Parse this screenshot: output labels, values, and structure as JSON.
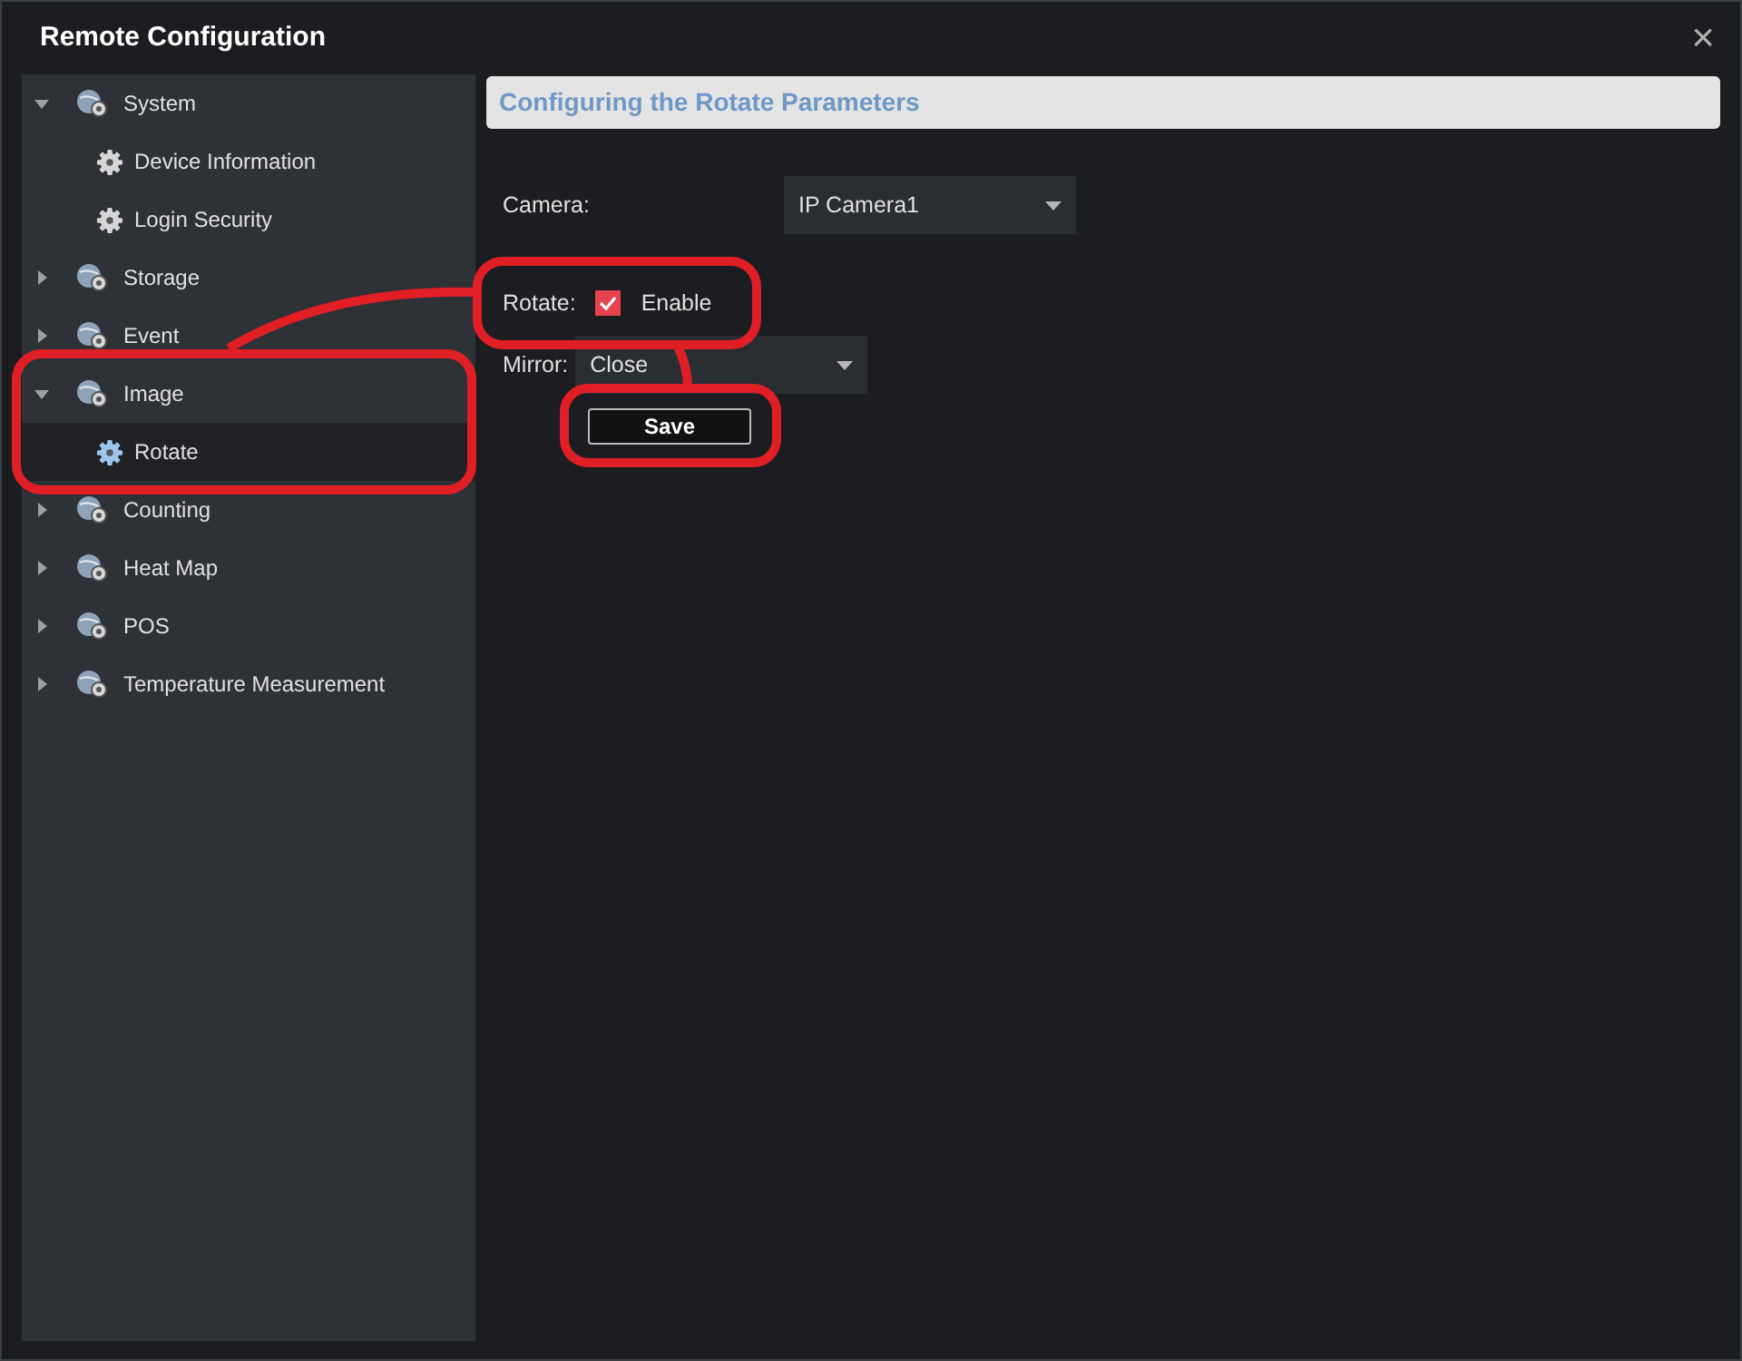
{
  "window": {
    "title": "Remote Configuration",
    "close": "×"
  },
  "tree": [
    {
      "label": "System",
      "expanded": true,
      "selected": false,
      "children": [
        {
          "label": "Device Information",
          "selected": false
        },
        {
          "label": "Login Security",
          "selected": false
        }
      ]
    },
    {
      "label": "Storage",
      "expanded": false,
      "selected": false
    },
    {
      "label": "Event",
      "expanded": false,
      "selected": false
    },
    {
      "label": "Image",
      "expanded": true,
      "selected": false,
      "children": [
        {
          "label": "Rotate",
          "selected": true
        }
      ]
    },
    {
      "label": "Counting",
      "expanded": false,
      "selected": false
    },
    {
      "label": "Heat Map",
      "expanded": false,
      "selected": false
    },
    {
      "label": "POS",
      "expanded": false,
      "selected": false
    },
    {
      "label": "Temperature Measurement",
      "expanded": false,
      "selected": false
    }
  ],
  "panel": {
    "title": "Configuring the Rotate Parameters",
    "camera": {
      "label": "Camera:",
      "value": "IP Camera1"
    },
    "rotate": {
      "label": "Rotate:",
      "option": "Enable",
      "checked": true
    },
    "mirror": {
      "label": "Mirror:",
      "value": "Close"
    },
    "save": "Save"
  }
}
